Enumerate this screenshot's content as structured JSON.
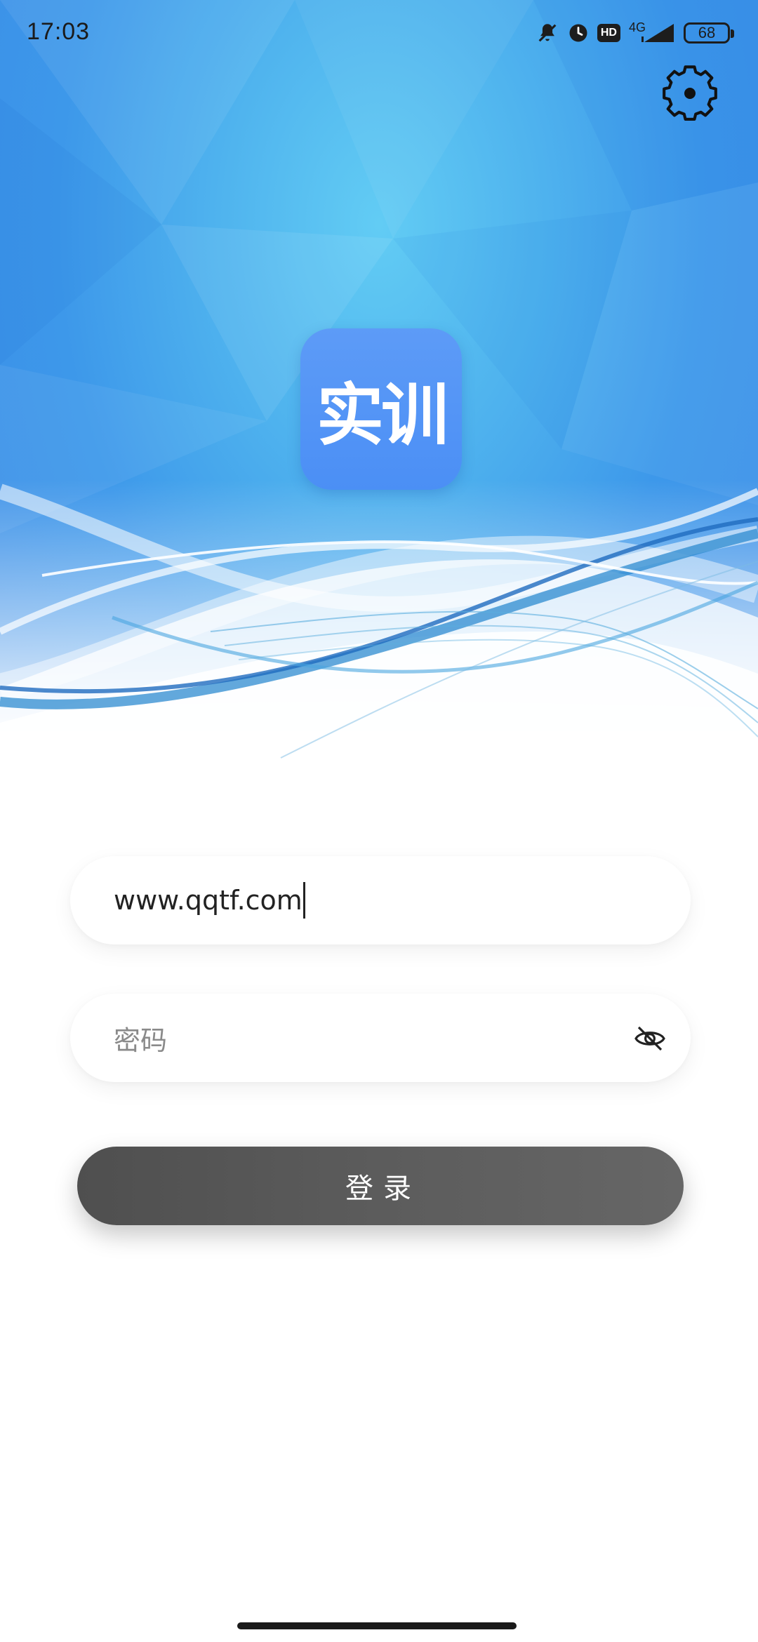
{
  "status_bar": {
    "time": "17:03",
    "network_type": "4G",
    "hd_label": "HD",
    "battery_level": "68",
    "icons": [
      "bell-muted-icon",
      "clock-icon",
      "hd-icon",
      "signal-icon",
      "battery-icon"
    ]
  },
  "header": {
    "settings_icon": "gear-icon",
    "logo_text": "实训"
  },
  "login_form": {
    "username_value": "www.qqtf.com",
    "password_placeholder": "密码",
    "password_toggle_icon": "eye-off-icon",
    "login_label": "登录"
  },
  "colors": {
    "hero_blue": "#3d98ea",
    "logo_blue": "#4b8ff5",
    "button_dark": "#555555"
  }
}
